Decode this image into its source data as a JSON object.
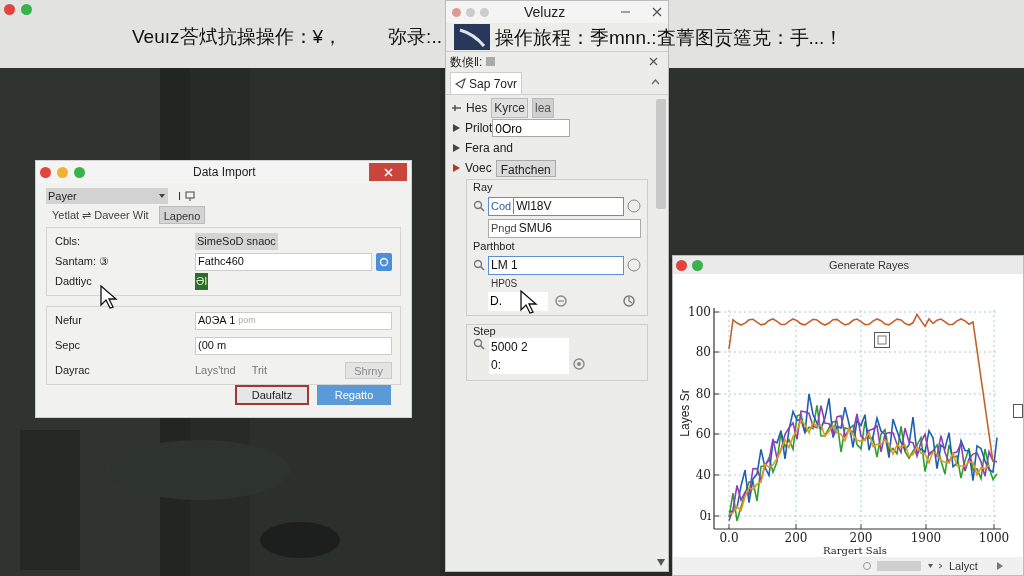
{
  "banner": {
    "left": "Veuız荅烒抗操操作：¥，",
    "middle": "弥录:..",
    "right": "操作旅程：季mnn.:査菁图贡簉克：手...！"
  },
  "panel": {
    "title": "Veluzz",
    "header": "数倏‖:",
    "tab": "Sap 7ovr",
    "rows": [
      {
        "kind": "tabs",
        "label": "Hes",
        "tabs": [
          {
            "label": "Kyrce",
            "selected": true
          },
          {
            "label": "lea",
            "selected": false
          }
        ]
      },
      {
        "kind": "field",
        "label": "Prilot",
        "value": "0Oro",
        "selected": false
      },
      {
        "kind": "plain",
        "label": "Fera and",
        "selected": false
      },
      {
        "kind": "tab",
        "label": "Voec",
        "value": "Fathchen",
        "selected": true
      }
    ],
    "groups": [
      {
        "title": "Ray",
        "items": [
          {
            "kind": "search",
            "prefix": "Cod",
            "value": "Wl18V"
          },
          {
            "kind": "field",
            "prefix": "Pngd",
            "value": "SMU6"
          }
        ]
      },
      {
        "title": "Parthbot",
        "items": [
          {
            "kind": "search",
            "value": "LM 1"
          },
          {
            "kind": "caption",
            "text": "HP0S"
          },
          {
            "kind": "small",
            "value": "D."
          }
        ]
      }
    ],
    "step": {
      "title": "Step",
      "lines": [
        "5000 2",
        "0:"
      ]
    }
  },
  "dialog": {
    "title": "Data Import",
    "dropdown": "Payer",
    "dropdown_aside": "I",
    "tabs": [
      {
        "label": "Yetlat ⇌ Daveer Wit",
        "selected": false
      },
      {
        "label": "Lapeno",
        "selected": true
      }
    ],
    "group1": [
      {
        "label": "Cbls:",
        "kind": "chip",
        "value": "SimeSoD snaoc"
      },
      {
        "label": "Santam: ③",
        "kind": "field",
        "value": "Fathc460"
      },
      {
        "label": "Dadtiyc",
        "kind": "tag",
        "value": "ƏI"
      }
    ],
    "group2": [
      {
        "label": "Nefur",
        "kind": "field",
        "value": "A0ЭA 1",
        "hint": "pom"
      },
      {
        "label": "Sepc",
        "kind": "field",
        "value": "(00 m"
      },
      {
        "label": "Dayrac",
        "kind": "options",
        "options": [
          "Lays'tnd",
          "Trit"
        ],
        "button": "Shrny"
      }
    ],
    "buttons": [
      {
        "label": "Daufaltz",
        "kind": "secondary"
      },
      {
        "label": "Regatto",
        "kind": "primary"
      }
    ]
  },
  "chart_window": {
    "title": "Generate Rayes",
    "ylabel": "Layes Sr",
    "xlabel": "Rargert Sals",
    "yticks": [
      "100",
      "80",
      "80",
      "60",
      "40",
      "0ı"
    ],
    "xticks": [
      "0.0",
      "200",
      "200",
      "1900",
      "1000"
    ],
    "footer": "Lalyct"
  }
}
